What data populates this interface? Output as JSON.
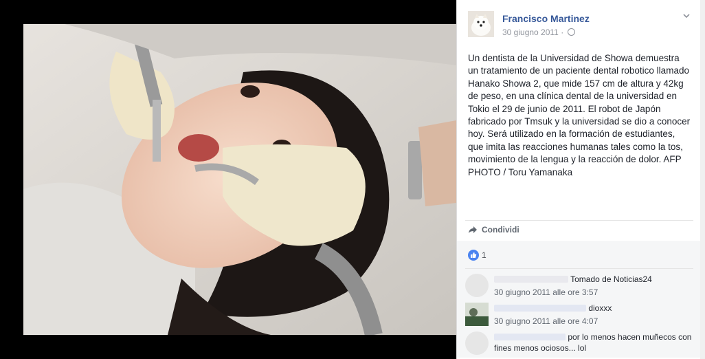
{
  "post": {
    "author": "Francisco Martinez",
    "date": "30 giugno 2011",
    "separator": "·",
    "caption": "Un dentista de la Universidad de Showa demuestra un tratamiento de un paciente dental robotico llamado Hanako Showa 2, que mide 157 cm de altura y 42kg de peso, en una clínica dental de la universidad en Tokio el 29 de junio de 2011. El robot de Japón fabricado por Tmsuk y la universidad se dio a conocer hoy. Será utilizado en la formación de estudiantes, que imita las reacciones humanas tales como la tos, movimiento de la lengua y la reacción de dolor. AFP PHOTO / Toru Yamanaka",
    "share_label": "Condividi",
    "like_count": "1"
  },
  "comments": [
    {
      "author": "",
      "text": "Tomado de Noticias24",
      "time": "30 giugno 2011 alle ore 3:57"
    },
    {
      "author": "",
      "text": "dioxxx",
      "time": "30 giugno 2011 alle ore 4:07"
    },
    {
      "author": "",
      "text": "por lo menos hacen muñecos con fines menos ociosos... lol",
      "time": ""
    }
  ],
  "icons": {
    "globe": "globe-icon",
    "chevron": "chevron-down-icon",
    "share": "share-arrow-icon",
    "like": "thumbs-up-icon"
  },
  "colors": {
    "link": "#365899",
    "like_badge": "#4a83f0",
    "background": "#000000"
  }
}
